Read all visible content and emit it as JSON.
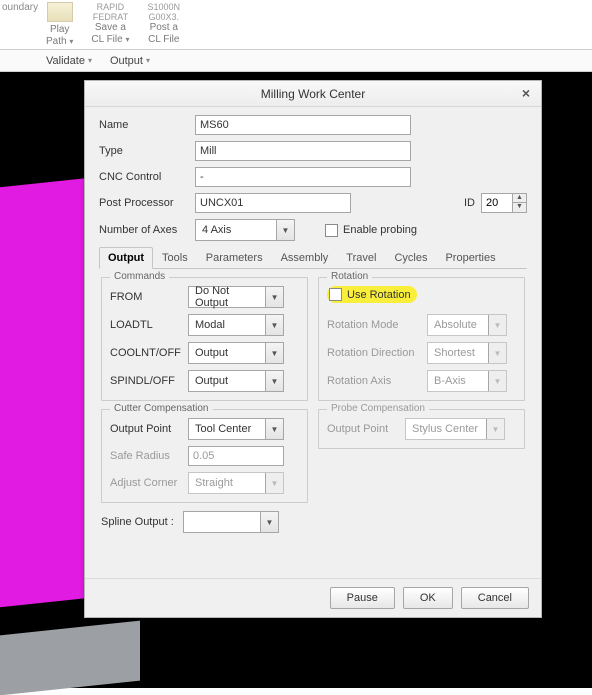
{
  "ribbon": {
    "items": [
      {
        "label": "Play\nPath",
        "caption": ""
      },
      {
        "label": "Save a\nCL File",
        "caption": "RAPID\nFEDRAT"
      },
      {
        "label": "Post a\nCL File",
        "caption": "S1000N\nG00X3."
      }
    ],
    "boundary_label": "oundary"
  },
  "menubar": {
    "validate": "Validate",
    "output": "Output"
  },
  "dialog": {
    "title": "Milling Work Center",
    "fields": {
      "name_label": "Name",
      "name_value": "MS60",
      "type_label": "Type",
      "type_value": "Mill",
      "cnc_label": "CNC Control",
      "cnc_value": "-",
      "postproc_label": "Post Processor",
      "postproc_value": "UNCX01",
      "id_label": "ID",
      "id_value": "20",
      "axes_label": "Number of Axes",
      "axes_value": "4 Axis",
      "enable_probing": "Enable probing"
    },
    "tabs": [
      "Output",
      "Tools",
      "Parameters",
      "Assembly",
      "Travel",
      "Cycles",
      "Properties"
    ],
    "output_tab": {
      "commands_legend": "Commands",
      "cmd_rows": [
        {
          "label": "FROM",
          "value": "Do Not Output"
        },
        {
          "label": "LOADTL",
          "value": "Modal"
        },
        {
          "label": "COOLNT/OFF",
          "value": "Output"
        },
        {
          "label": "SPINDL/OFF",
          "value": "Output"
        }
      ],
      "cutter_comp_legend": "Cutter Compensation",
      "cutter_rows": {
        "output_point_label": "Output Point",
        "output_point_value": "Tool Center",
        "safe_radius_label": "Safe Radius",
        "safe_radius_value": "0.05",
        "adjust_corner_label": "Adjust Corner",
        "adjust_corner_value": "Straight"
      },
      "spline_label": "Spline Output :",
      "rotation_legend": "Rotation",
      "use_rotation": "Use Rotation",
      "rotation_rows": {
        "mode_label": "Rotation Mode",
        "mode_value": "Absolute",
        "dir_label": "Rotation Direction",
        "dir_value": "Shortest",
        "axis_label": "Rotation Axis",
        "axis_value": "B-Axis"
      },
      "probe_legend": "Probe Compensation",
      "probe_rows": {
        "output_point_label": "Output Point",
        "output_point_value": "Stylus Center"
      }
    },
    "buttons": {
      "pause": "Pause",
      "ok": "OK",
      "cancel": "Cancel"
    }
  }
}
